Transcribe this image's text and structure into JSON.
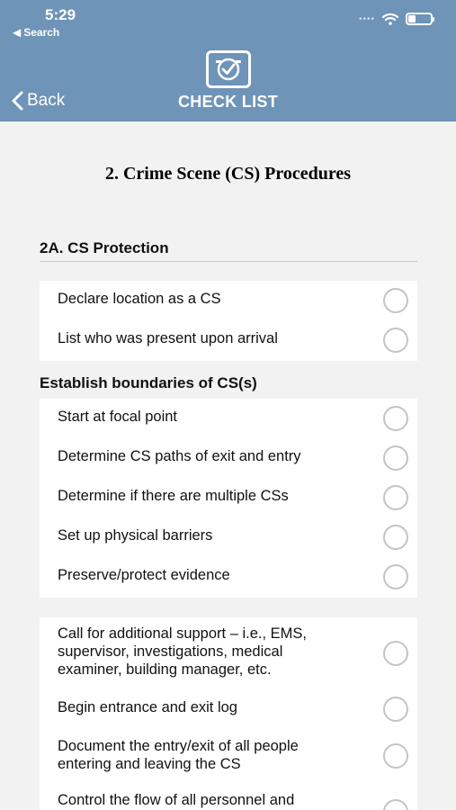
{
  "status_bar": {
    "time": "5:29",
    "back_label": "Search"
  },
  "nav": {
    "back_label": "Back",
    "title": "CHECK LIST"
  },
  "page_title": "2. Crime Scene (CS) Procedures",
  "section": {
    "title": "2A. CS Protection"
  },
  "group1": {
    "items": [
      "Declare location as a CS",
      "List who was present upon arrival"
    ]
  },
  "group2": {
    "title": "Establish boundaries of CS(s)",
    "items": [
      "Start at focal point",
      "Determine CS paths of exit and entry",
      "Determine if there are multiple CSs",
      "Set up physical barriers",
      "Preserve/protect evidence"
    ]
  },
  "group3": {
    "items": [
      [
        "Call for additional support – i.e., EMS,",
        "supervisor, investigations, medical",
        "examiner, building manager, etc."
      ],
      [
        "Begin entrance and exit log"
      ],
      [
        "Document the entry/exit of all people",
        "entering and leaving the CS"
      ],
      [
        "Control the flow of all personnel and"
      ]
    ]
  },
  "colors": {
    "header": "#6e94b7",
    "background": "#f2f2f3",
    "card": "#ffffff"
  },
  "battery_level": 0.35
}
